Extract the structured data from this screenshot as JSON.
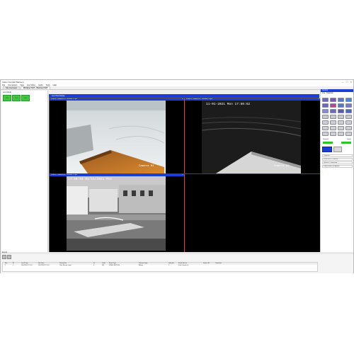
{
  "window": {
    "title": "Video Central Platinum",
    "controls": [
      "—",
      "☐",
      "✕"
    ]
  },
  "menu": [
    "File",
    "Connection",
    "View",
    "Live Video",
    "Audio",
    "Tools",
    "Help"
  ],
  "tabs": [
    "Site Overview",
    "Worknet SAT - Worknet SAT"
  ],
  "left_panel": {
    "header": "Live Mode",
    "buttons": [
      "CH 1",
      "CH 2",
      "CH 3"
    ]
  },
  "video_header": "Live Tiles Display",
  "tiles": [
    {
      "label": "iCam 8 • Camera 01 • 704x480 • 4 fps",
      "stamp": "Camera 01"
    },
    {
      "label": "iCam 8 • Camera 02 • 704x480 • 4 fps",
      "timestamp": "11-01-2021 Mon 17:50:52",
      "stamp": "Camera 02"
    },
    {
      "label": "iCam 8 • Camera 03 • 704x480 • 4 fps",
      "timestamp": "17:00:04 01/11/2021 Mon"
    },
    {
      "label": "",
      "stamp": ""
    }
  ],
  "right_panel": {
    "title": "Control",
    "tabs": [
      "Live",
      "Playback"
    ],
    "status_labels": [
      "Network",
      "Audio"
    ],
    "fields": [
      "Camera 1",
      "11/01/2021 17:00:04",
      "System: Connected",
      "CAN-Frodo Fan Active"
    ]
  },
  "events": {
    "title": "Events",
    "columns": [
      "Site",
      "ID",
      "Local Time",
      "Site Time",
      "Description",
      "Id",
      "Code",
      "Event Type",
      "Detector Type",
      "Indicator",
      "Event Source",
      "Source ID",
      "Comment"
    ],
    "row": [
      "1",
      "1",
      "11/01/2021 17:50",
      "11/01/2021 17:50",
      "Data Stream event",
      "0",
      "001",
      "VIDEO MOTION",
      "Motion",
      "1",
      "iCam Camera 3",
      "",
      ""
    ]
  }
}
